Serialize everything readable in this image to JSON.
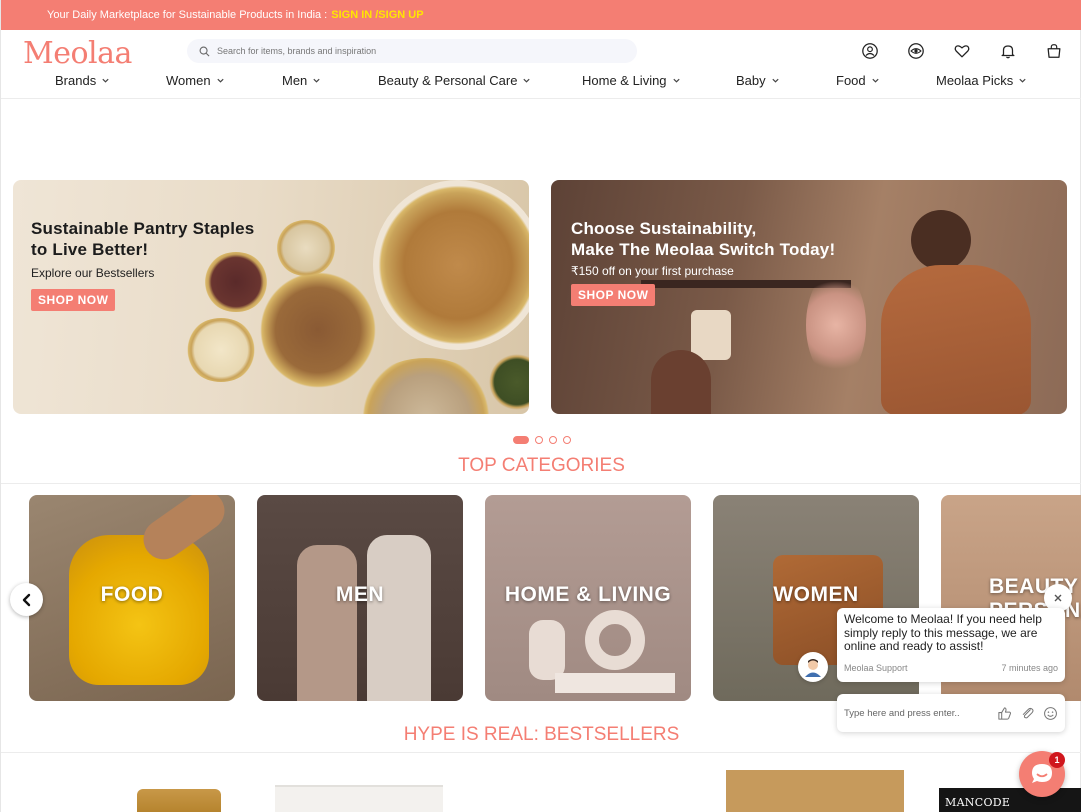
{
  "topbar": {
    "promo_text": "Your Daily Marketplace for Sustainable Products in India :",
    "signin_label": "SIGN IN /SIGN UP",
    "background": "#f47e73",
    "link_color": "#ffe600"
  },
  "header": {
    "logo": "Meolaa",
    "search_placeholder": "Search for items, brands and inspiration",
    "icons": [
      "account-icon",
      "eye-icon",
      "heart-icon",
      "bell-icon",
      "bag-icon"
    ]
  },
  "nav": {
    "items": [
      {
        "label": "Brands"
      },
      {
        "label": "Women"
      },
      {
        "label": "Men"
      },
      {
        "label": "Beauty & Personal Care"
      },
      {
        "label": "Home & Living"
      },
      {
        "label": "Baby"
      },
      {
        "label": "Food"
      },
      {
        "label": "Meolaa Picks"
      }
    ]
  },
  "banners": [
    {
      "title_line1": "Sustainable Pantry Staples",
      "title_line2": "to Live Better!",
      "subtitle": "Explore our Bestsellers",
      "button": "SHOP NOW"
    },
    {
      "title_line1": "Choose Sustainability,",
      "title_line2": "Make The Meolaa Switch Today!",
      "subtitle": "₹150 off on your first purchase",
      "button": "SHOP NOW"
    }
  ],
  "carousel": {
    "active_index": 0,
    "count": 4
  },
  "sections": {
    "top_categories": "TOP CATEGORIES",
    "bestsellers": "HYPE IS REAL: BESTSELLERS"
  },
  "categories": [
    {
      "label": "FOOD"
    },
    {
      "label": "MEN"
    },
    {
      "label": "HOME & LIVING"
    },
    {
      "label": "WOMEN"
    },
    {
      "label": "BEAUTY & PERSONAL CARE"
    }
  ],
  "chat": {
    "message": "Welcome to Meolaa! If you need help simply reply to this message, we are online and ready to assist!",
    "agent": "Meolaa Support",
    "time": "7 minutes ago",
    "input_placeholder": "Type here and press enter..",
    "badge_count": "1"
  },
  "products": {
    "brand_text": "MANCODE"
  },
  "colors": {
    "accent": "#f47e73",
    "badge": "#d0161d"
  }
}
